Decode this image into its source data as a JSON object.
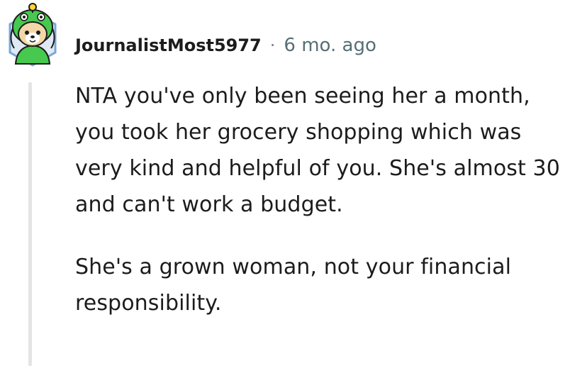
{
  "comment": {
    "username": "JournalistMost5977",
    "separator": "·",
    "timestamp": "6 mo. ago",
    "avatar_icon": "snoo-avatar-green-hood-icon",
    "paragraphs": [
      "NTA you've only been seeing her a month, you took her grocery shopping which was very kind and helpful of you. She's almost 30 and can't work a budget.",
      "She's a grown woman, not your financial responsibility."
    ]
  },
  "colors": {
    "text": "#1c1c1c",
    "meta": "#576f76",
    "thread_line": "#e4e4e4",
    "avatar_hood": "#46c94e",
    "avatar_frame": "#7aa7d6"
  }
}
